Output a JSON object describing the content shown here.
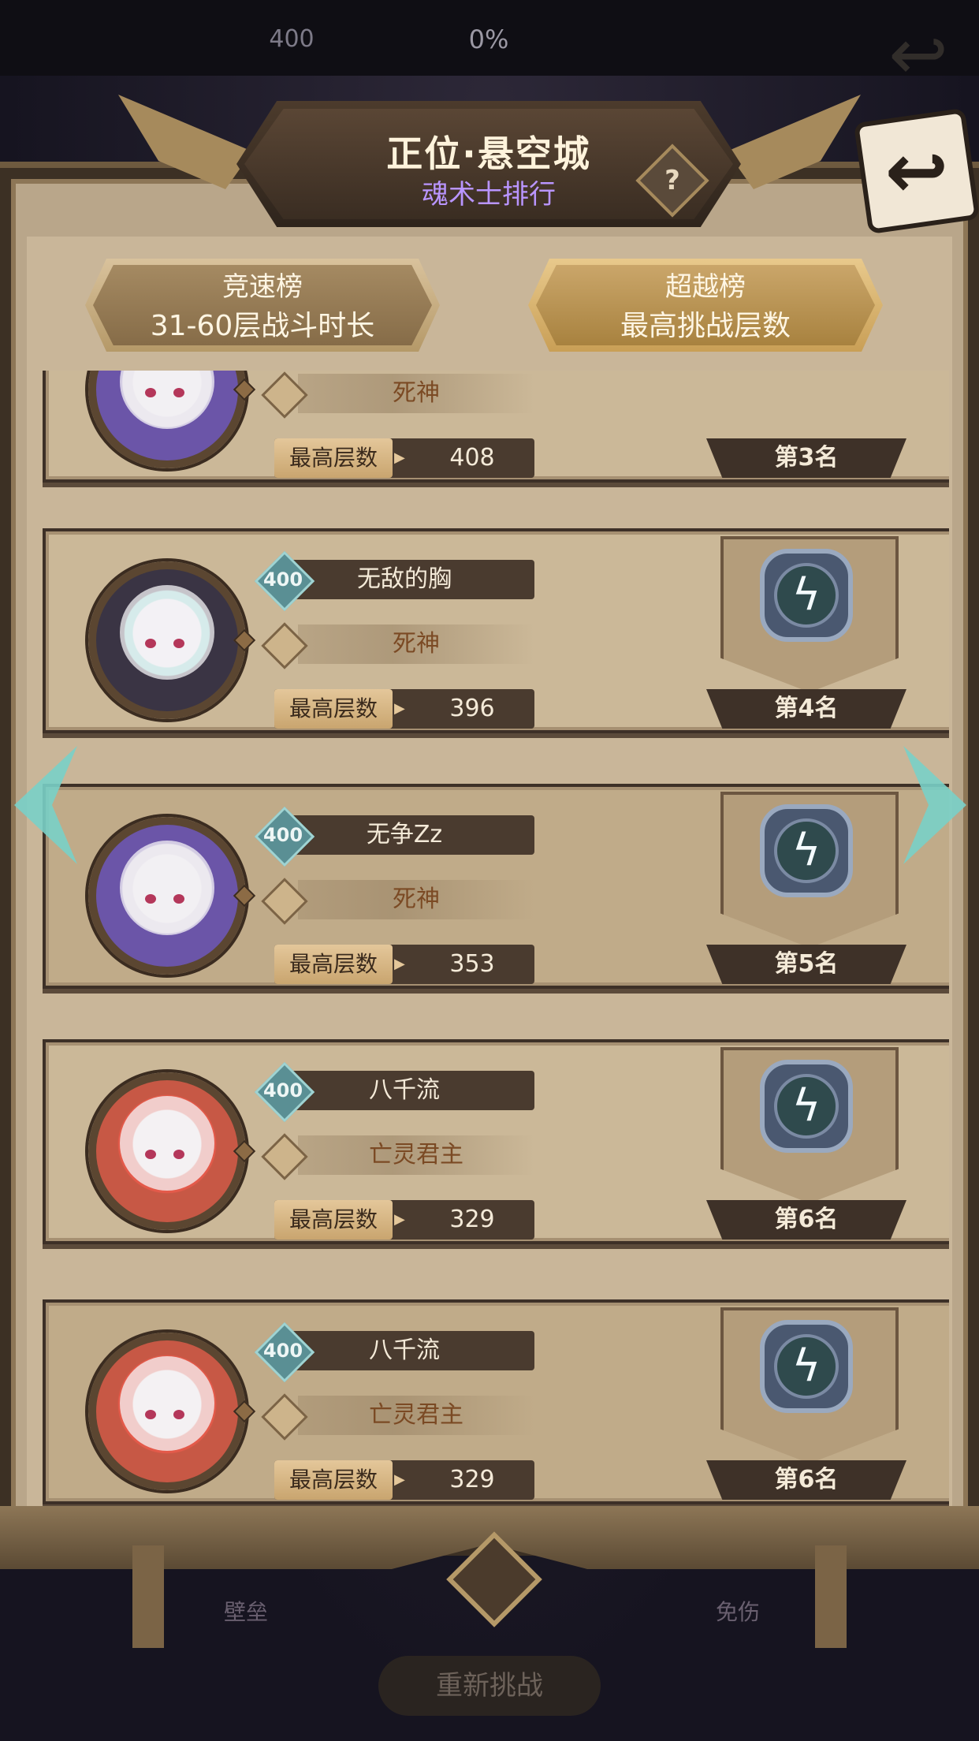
{
  "topbar": {
    "level": "400",
    "progress": "0%"
  },
  "header": {
    "title": "正位·悬空城",
    "subtitle": "魂术士排行"
  },
  "tabs": [
    {
      "title": "竞速榜",
      "subtitle": "31-60层战斗时长",
      "active": false
    },
    {
      "title": "超越榜",
      "subtitle": "最高挑战层数",
      "active": true
    }
  ],
  "entries": [
    {
      "level": "",
      "name": "",
      "title": "死神",
      "score_label": "最高层数",
      "score": "408",
      "rank": "第3名"
    },
    {
      "level": "400",
      "name": "无敌的胸",
      "title": "死神",
      "score_label": "最高层数",
      "score": "396",
      "rank": "第4名"
    },
    {
      "level": "400",
      "name": "无争Zz",
      "title": "死神",
      "score_label": "最高层数",
      "score": "353",
      "rank": "第5名"
    },
    {
      "level": "400",
      "name": "八千流",
      "title": "亡灵君主",
      "score_label": "最高层数",
      "score": "329",
      "rank": "第6名"
    },
    {
      "level": "400",
      "name": "八千流",
      "title": "亡灵君主",
      "score_label": "最高层数",
      "score": "329",
      "rank": "第6名"
    }
  ],
  "background": {
    "left_label": "壁垒",
    "right_label": "免伤",
    "retry": "重新挑战"
  },
  "icons": {
    "help": "?",
    "back": "back-arrow-icon",
    "medal": "lightning-medal-icon"
  },
  "colors": {
    "accent_teal": "#79d0c8",
    "title_purple": "#b995ff",
    "panel": "#c9b699"
  }
}
